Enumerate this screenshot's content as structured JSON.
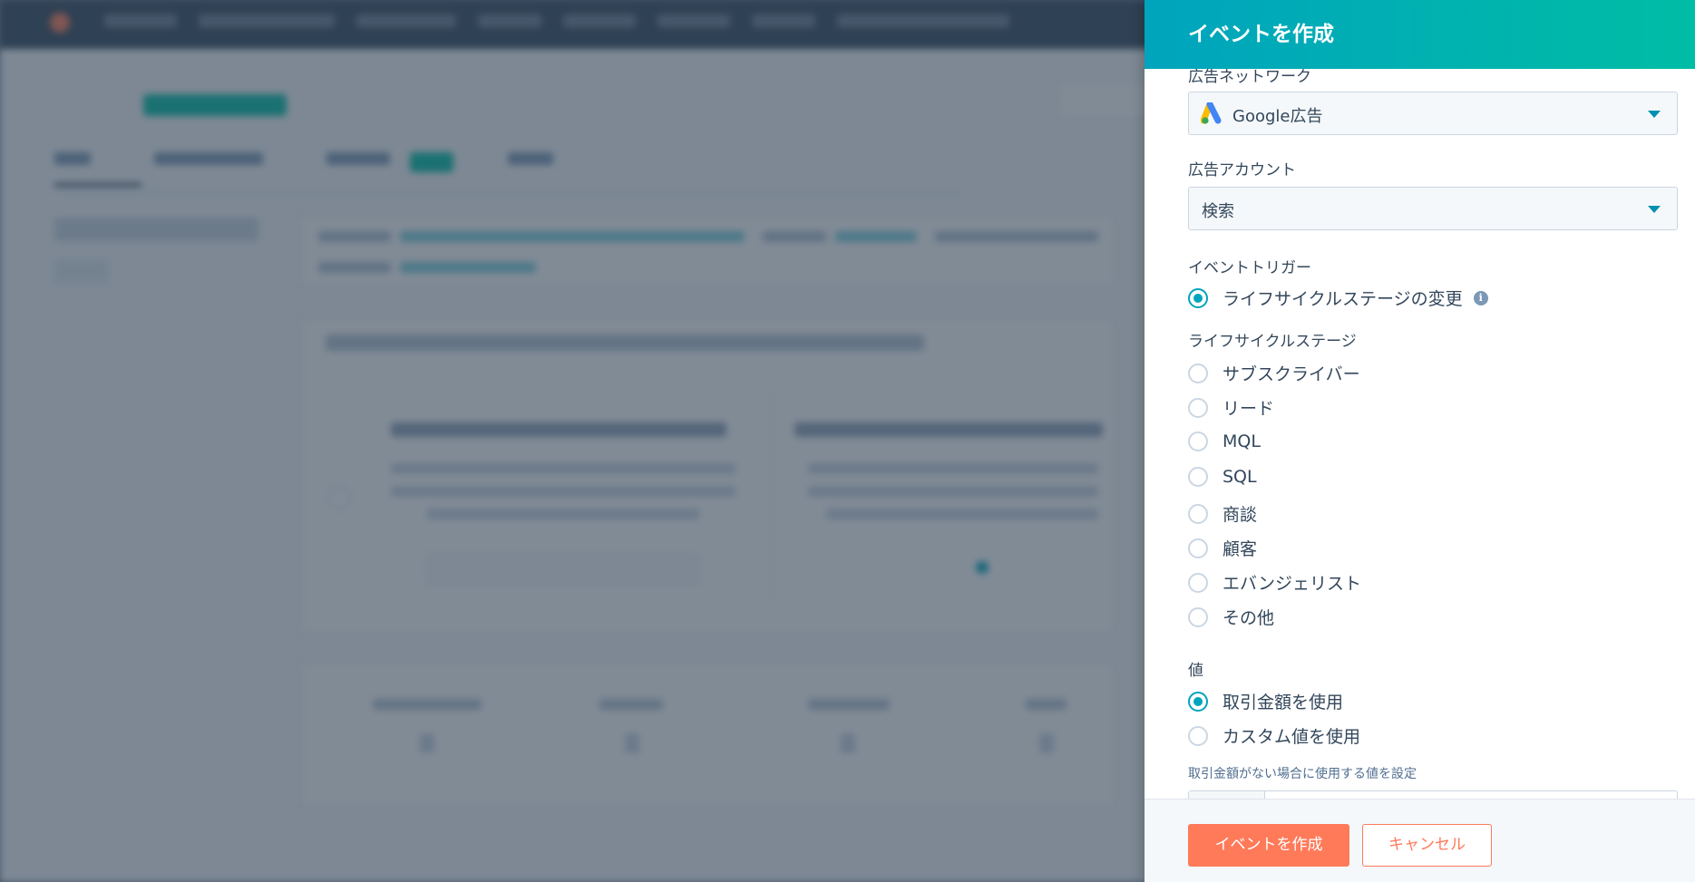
{
  "panel": {
    "title": "イベントを作成",
    "ad_network": {
      "label": "広告ネットワーク",
      "selected": "Google広告",
      "icon": "google-ads-icon"
    },
    "ad_account": {
      "label": "広告アカウント",
      "selected": "検索"
    },
    "event_trigger": {
      "label": "イベントトリガー",
      "option": "ライフサイクルステージの変更",
      "checked": true
    },
    "lifecycle_stage": {
      "label": "ライフサイクルステージ",
      "options": [
        {
          "label": "サブスクライバー",
          "checked": false
        },
        {
          "label": "リード",
          "checked": false
        },
        {
          "label": "MQL",
          "checked": false
        },
        {
          "label": "SQL",
          "checked": false
        },
        {
          "label": "商談",
          "checked": false
        },
        {
          "label": "顧客",
          "checked": false
        },
        {
          "label": "エバンジェリスト",
          "checked": false
        },
        {
          "label": "その他",
          "checked": false
        }
      ]
    },
    "value": {
      "label": "値",
      "options": [
        {
          "label": "取引金額を使用",
          "checked": true
        },
        {
          "label": "カスタム値を使用",
          "checked": false
        }
      ],
      "help": "取引金額がない場合に使用する値を設定"
    },
    "footer": {
      "create_label": "イベントを作成",
      "cancel_label": "キャンセル"
    }
  },
  "colors": {
    "accent": "#00a4bd",
    "primary_button": "#ff7a59",
    "text": "#33475b"
  }
}
